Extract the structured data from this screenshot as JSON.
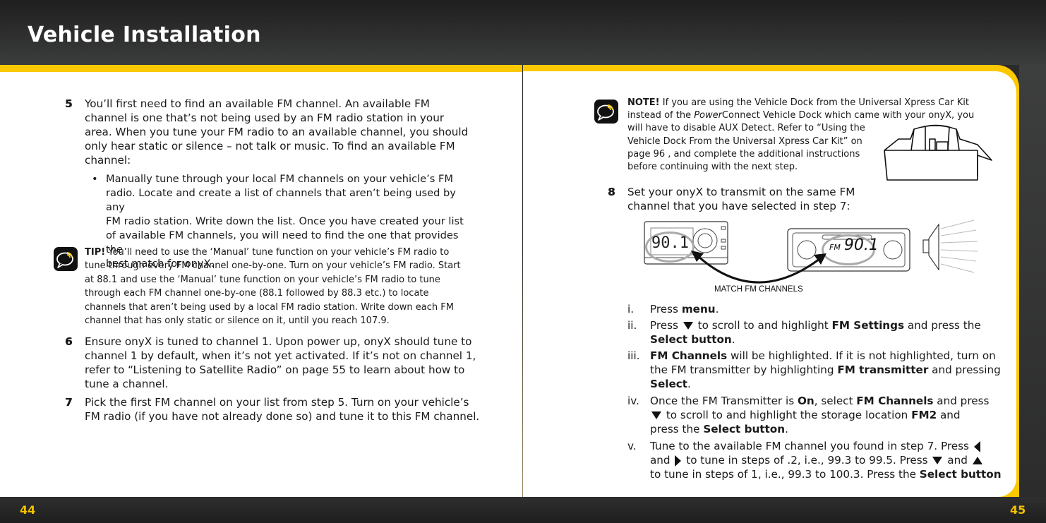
{
  "header": {
    "title": "Vehicle Installation"
  },
  "footer": {
    "page_left": "44",
    "page_right": "45"
  },
  "colors": {
    "accent": "#fcc800",
    "page_number": "#f2c100",
    "bar_dark": "#2a2a2a"
  },
  "left_page": {
    "step5": {
      "number": "5",
      "text": "You’ll first need to find an available FM channel. An available FM channel is one that’s not being used by an FM radio station in your area. When you tune your FM radio to an available channel, you should only hear static or silence – not talk or music. To find an available FM channel:",
      "lines": [
        "You’ll first need to find an available FM channel. An available FM",
        "channel is one that’s not being used by an FM radio station in your",
        "area. When you tune your FM radio to an available channel, you should",
        "only hear static or silence – not talk or music. To find an available FM",
        "channel:"
      ],
      "bullet": {
        "symbol": "•",
        "lines": [
          "Manually tune through your local FM channels on your vehicle’s FM",
          "radio. Locate and create a list of channels that aren’t being used by any",
          "FM radio station. Write down the list.  Once you have created your list",
          "of available FM channels, you will need to find the one that provides the",
          "best match for onyX."
        ]
      }
    },
    "tip": {
      "icon": "speech-bubble-signal-icon",
      "label": "TIP!",
      "lines": [
        " You’ll need to use the ‘Manual’ tune function on your vehicle’s FM radio to",
        "tune through every FM channel one-by-one. Turn on your vehicle’s FM radio.  Start",
        "at 88.1 and use the ‘Manual’ tune function on your vehicle’s FM radio to tune",
        "through each FM channel one-by-one (88.1 followed by 88.3 etc.) to locate",
        "channels that aren’t being used by a local FM radio station. Write down each FM",
        "channel that has only static or silence on it, until you reach 107.9."
      ]
    },
    "step6": {
      "number": "6",
      "lines": [
        "Ensure onyX is tuned to channel 1. Upon power up, onyX should tune to",
        "channel 1 by default, when it’s not yet activated. If it’s not on channel 1,",
        "refer to “Listening to Satellite Radio” on page 55 to learn about how to",
        "tune a channel."
      ]
    },
    "step7": {
      "number": "7",
      "lines": [
        "Pick the first FM channel on your list from step 5. Turn on your vehicle’s",
        "FM radio (if you have not already done so) and tune it to this FM channel."
      ]
    }
  },
  "right_page": {
    "note": {
      "icon": "speech-bubble-signal-icon",
      "label": "NOTE!",
      "line1": " If you are using the Vehicle Dock from the Universal Xpress Car Kit",
      "line2_pre": "instead of the ",
      "line2_italic": "Power",
      "line2_post": "Connect Vehicle Dock which came with your onyX, you",
      "lines_rest": [
        "will have to disable AUX Detect. Refer to “Using the",
        "Vehicle Dock From the Universal Xpress Car Kit” on",
        "page 96 , and complete the additional instructions",
        "before continuing with the next step."
      ],
      "image": "vehicle-dock-illustration"
    },
    "step8": {
      "number": "8",
      "lines": [
        "Set your onyX to transmit on the same FM",
        "channel that you have selected in step 7:"
      ]
    },
    "diagram": {
      "onyx_display": "90.1",
      "car_radio_band": "FM",
      "car_radio_display": "90.1",
      "caption": "MATCH FM CHANNELS"
    },
    "substeps": {
      "i": {
        "num": "i.",
        "t1": "Press ",
        "b1": "menu",
        "t2": "."
      },
      "ii": {
        "num": "ii.",
        "t1": "Press ",
        "t2": " to scroll to and highlight ",
        "b1": "FM Settings",
        "t3": " and press the",
        "b2": "Select button",
        "t4": "."
      },
      "iii": {
        "num": "iii.",
        "b1": "FM Channels",
        "t1": " will be highlighted. If it is not highlighted, turn on",
        "t2": "the FM transmitter by highlighting ",
        "b2": "FM transmitter",
        "t3": " and pressing",
        "b3": "Select",
        "t4": "."
      },
      "iv": {
        "num": "iv.",
        "t1": "Once the FM Transmitter is ",
        "b1": "On",
        "t2": ", select ",
        "b2": "FM Channels",
        "t3": " and press",
        "t4": " to scroll to and highlight the storage location ",
        "b3": "FM2",
        "t5": " and",
        "t6": "press the ",
        "b4": "Select button",
        "t7": "."
      },
      "v": {
        "num": "v.",
        "t1": "Tune to the available FM channel you found in step 7. Press ",
        "t2": "and ",
        "t3": " to tune in steps of .2, i.e., 99.3 to 99.5. Press ",
        "t4": " and ",
        "t5": "to tune in steps of 1, i.e., 99.3 to 100.3. Press the ",
        "b1": "Select button"
      }
    }
  }
}
